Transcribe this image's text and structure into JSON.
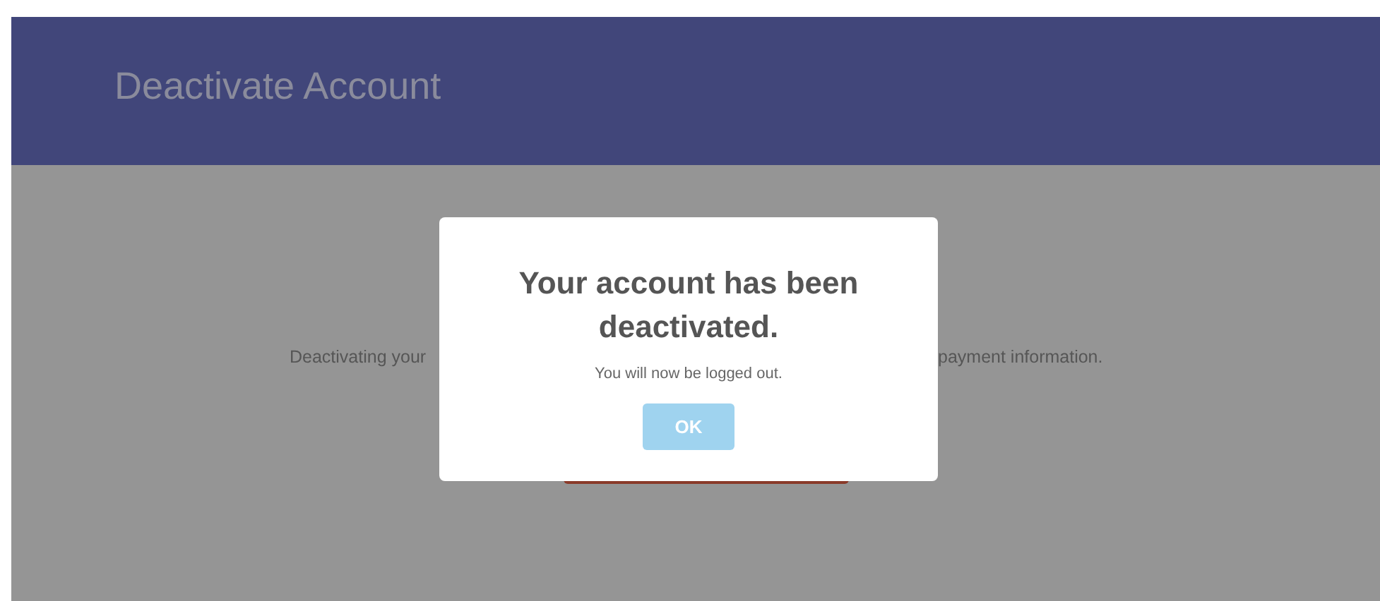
{
  "header": {
    "title": "Deactivate Account"
  },
  "page": {
    "text_left": "Deactivating your",
    "text_right": "payment information."
  },
  "dialog": {
    "title": "Your account has been deactivated.",
    "message": "You will now be logged out.",
    "buttons": [
      {
        "label": "OK"
      }
    ]
  }
}
